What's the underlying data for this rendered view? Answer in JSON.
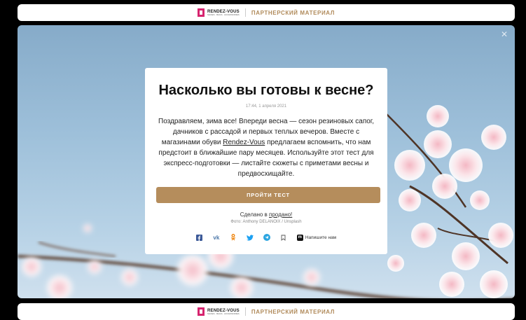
{
  "top_banner": {
    "brand_name": "RENDEZ-VOUS",
    "brand_sub": "SHOES · BAGS · ACCESSORIES",
    "partner_label": "ПАРТНЕРСКИЙ МАТЕРИАЛ"
  },
  "bottom_banner": {
    "brand_name": "RENDEZ-VOUS",
    "brand_sub": "SHOES · BAGS · ACCESSORIES",
    "partner_label": "ПАРТНЕРСКИЙ МАТЕРИАЛ"
  },
  "hero": {
    "close_icon": "close-icon"
  },
  "card": {
    "title": "Насколько вы готовы к весне?",
    "date": "17:44, 1 апреля 2021",
    "body_before_link": "Поздравляем, зима все! Впереди весна — сезон резиновых сапог, дачников с рассадой и первых теплых вечеров. Вместе с магазинами обуви ",
    "body_link": "Rendez-Vous",
    "body_after_link": " предлагаем вспомнить, что нам предстоит в ближайшие пару месяцев. Используйте этот тест для экспресс-подготовки — листайте сюжеты с приметами весны и предвосхищайте.",
    "cta_label": "ПРОЙТИ ТЕСТ",
    "made_prefix": "Сделано в ",
    "made_link": "продано!",
    "photo_credit": "Фото: Anthony DELANOIX / Unsplash",
    "write_label": "Напишите нам"
  },
  "share_icons": [
    "facebook-icon",
    "vk-icon",
    "odnoklassniki-icon",
    "twitter-icon",
    "telegram-icon",
    "bookmark-icon"
  ],
  "colors": {
    "accent": "#b58d5c",
    "partner_text": "#b08a5a",
    "brand_mark": "#d6246e",
    "facebook": "#3b5998",
    "vk": "#4a76a8",
    "ok": "#ee8208",
    "twitter": "#1da1f2",
    "telegram": "#2ca5e0"
  }
}
